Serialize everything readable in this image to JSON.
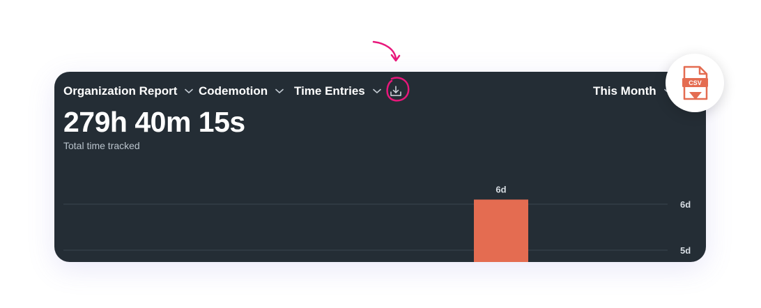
{
  "header": {
    "report_dropdown": "Organization Report",
    "org_dropdown": "Codemotion",
    "type_dropdown": "Time Entries",
    "period_dropdown": "This Month"
  },
  "summary": {
    "total": "279h 40m 15s",
    "total_label": "Total time tracked"
  },
  "csv_badge": {
    "text": "CSV"
  },
  "colors": {
    "card_bg": "#242d35",
    "bar": "#e46c51",
    "annotation": "#e8177b",
    "csv_icon": "#e46c51"
  },
  "icons": {
    "download": "download-icon",
    "chevron": "chevron-down-icon",
    "csv": "csv-file-icon"
  },
  "chart_data": {
    "type": "bar",
    "y_ticks": [
      "6d",
      "5d"
    ],
    "bars": [
      {
        "label": "6d",
        "value_days": 6.1
      }
    ],
    "grid": true
  }
}
